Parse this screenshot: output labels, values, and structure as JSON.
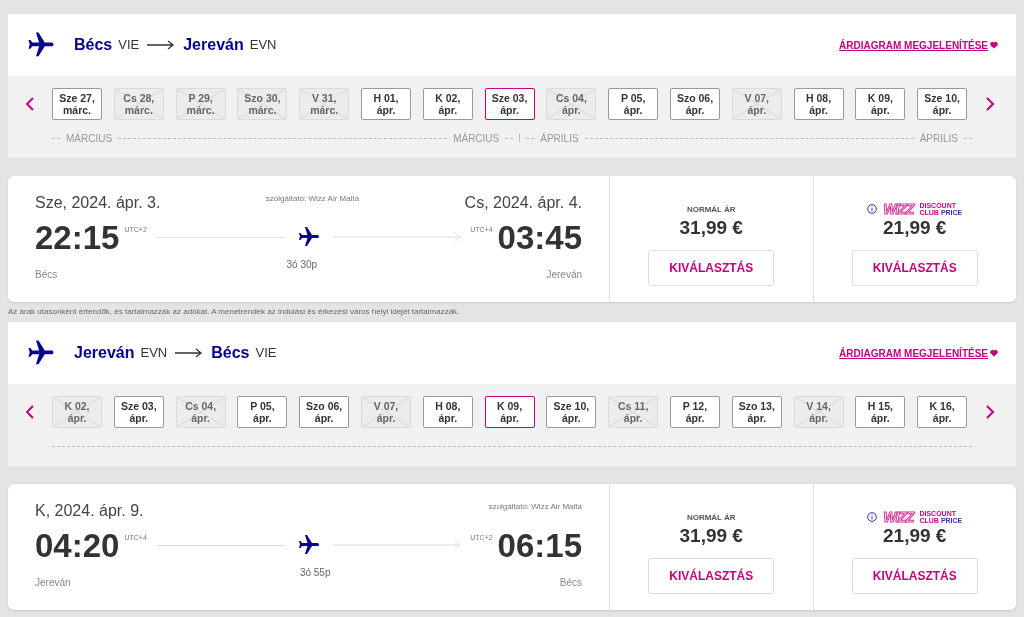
{
  "legs": [
    {
      "from_city": "Bécs",
      "from_code": "VIE",
      "to_city": "Jereván",
      "to_code": "EVN",
      "chart_link": "ÁRDIAGRAM MEGJELENÍTÉSE",
      "dates": [
        {
          "day": "Sze 27,",
          "month": "márc.",
          "disabled": false,
          "selected": false
        },
        {
          "day": "Cs 28,",
          "month": "márc.",
          "disabled": true,
          "selected": false
        },
        {
          "day": "P 29,",
          "month": "márc.",
          "disabled": true,
          "selected": false
        },
        {
          "day": "Szo 30,",
          "month": "márc.",
          "disabled": true,
          "selected": false
        },
        {
          "day": "V 31,",
          "month": "márc.",
          "disabled": true,
          "selected": false
        },
        {
          "day": "H 01,",
          "month": "ápr.",
          "disabled": false,
          "selected": false
        },
        {
          "day": "K 02,",
          "month": "ápr.",
          "disabled": false,
          "selected": false
        },
        {
          "day": "Sze 03,",
          "month": "ápr.",
          "disabled": false,
          "selected": true
        },
        {
          "day": "Cs 04,",
          "month": "ápr.",
          "disabled": true,
          "selected": false
        },
        {
          "day": "P 05,",
          "month": "ápr.",
          "disabled": false,
          "selected": false
        },
        {
          "day": "Szo 06,",
          "month": "ápr.",
          "disabled": false,
          "selected": false
        },
        {
          "day": "V 07,",
          "month": "ápr.",
          "disabled": true,
          "selected": false
        },
        {
          "day": "H 08,",
          "month": "ápr.",
          "disabled": false,
          "selected": false
        },
        {
          "day": "K 09,",
          "month": "ápr.",
          "disabled": false,
          "selected": false
        },
        {
          "day": "Sze 10,",
          "month": "ápr.",
          "disabled": false,
          "selected": false
        }
      ],
      "month_labels": [
        "MÁRCIUS",
        "MÁRCIUS",
        "ÁPRILIS",
        "ÁPRILIS"
      ],
      "flight": {
        "departure_date": "Sze, 2024. ápr. 3.",
        "provider": "szolgáltató: Wizz Air Malta",
        "arrival_date": "Cs, 2024. ápr. 4.",
        "departure_time": "22:15",
        "departure_utc": "UTC+2",
        "duration": "3ó 30p",
        "arrival_utc": "UTC+4",
        "arrival_time": "03:45",
        "departure_city": "Bécs",
        "arrival_city": "Jereván"
      },
      "prices": [
        {
          "kind": "normal",
          "label": "NORMÁL ÁR",
          "price": "31,99 €",
          "button": "KIVÁLASZTÁS"
        },
        {
          "kind": "club",
          "brand": "WIZZ",
          "tag_1": "DISCOUNT",
          "tag_2": "CLUB",
          "tag_3": "PRICE",
          "price": "21,99 €",
          "button": "KIVÁLASZTÁS"
        }
      ]
    },
    {
      "from_city": "Jereván",
      "from_code": "EVN",
      "to_city": "Bécs",
      "to_code": "VIE",
      "chart_link": "ÁRDIAGRAM MEGJELENÍTÉSE",
      "dates": [
        {
          "day": "K 02,",
          "month": "ápr.",
          "disabled": true,
          "selected": false
        },
        {
          "day": "Sze 03,",
          "month": "ápr.",
          "disabled": false,
          "selected": false
        },
        {
          "day": "Cs 04,",
          "month": "ápr.",
          "disabled": true,
          "selected": false
        },
        {
          "day": "P 05,",
          "month": "ápr.",
          "disabled": false,
          "selected": false
        },
        {
          "day": "Szo 06,",
          "month": "ápr.",
          "disabled": false,
          "selected": false
        },
        {
          "day": "V 07,",
          "month": "ápr.",
          "disabled": true,
          "selected": false
        },
        {
          "day": "H 08,",
          "month": "ápr.",
          "disabled": false,
          "selected": false
        },
        {
          "day": "K 09,",
          "month": "ápr.",
          "disabled": false,
          "selected": true
        },
        {
          "day": "Sze 10,",
          "month": "ápr.",
          "disabled": false,
          "selected": false
        },
        {
          "day": "Cs 11,",
          "month": "ápr.",
          "disabled": true,
          "selected": false
        },
        {
          "day": "P 12,",
          "month": "ápr.",
          "disabled": false,
          "selected": false
        },
        {
          "day": "Szo 13,",
          "month": "ápr.",
          "disabled": false,
          "selected": false
        },
        {
          "day": "V 14,",
          "month": "ápr.",
          "disabled": true,
          "selected": false
        },
        {
          "day": "H 15,",
          "month": "ápr.",
          "disabled": false,
          "selected": false
        },
        {
          "day": "K 16,",
          "month": "ápr.",
          "disabled": false,
          "selected": false
        }
      ],
      "flight": {
        "departure_date": "K, 2024. ápr. 9.",
        "provider": "szolgáltató: Wizz Air Malta",
        "departure_time": "04:20",
        "departure_utc": "UTC+4",
        "duration": "3ó 55p",
        "arrival_utc": "UTC+2",
        "arrival_time": "06:15",
        "departure_city": "Jereván",
        "arrival_city": "Bécs"
      },
      "prices": [
        {
          "kind": "normal",
          "label": "NORMÁL ÁR",
          "price": "31,99 €",
          "button": "KIVÁLASZTÁS"
        },
        {
          "kind": "club",
          "brand": "WIZZ",
          "tag_1": "DISCOUNT",
          "tag_2": "CLUB",
          "tag_3": "PRICE",
          "price": "21,99 €",
          "button": "KIVÁLASZTÁS"
        }
      ]
    }
  ],
  "disclaimer": "Az árak utasonként értendők, és tartalmazzák az adókat. A menetrendek az indulási és érkezési város helyi idejét tartalmazzák."
}
